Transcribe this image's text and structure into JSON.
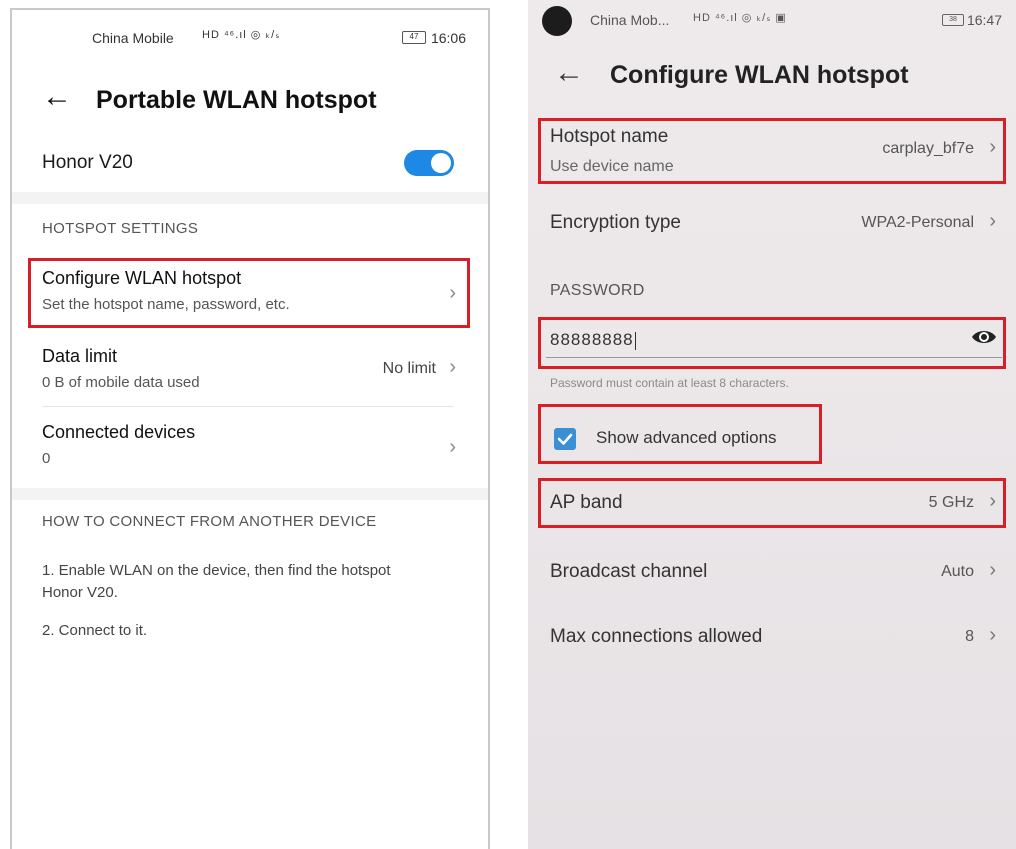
{
  "left": {
    "status": {
      "carrier": "China Mobile",
      "signal": "HD ⁴⁶.ıl ◎ ₖ/ₛ",
      "battery": "47",
      "time": "16:06"
    },
    "header": {
      "title": "Portable WLAN hotspot"
    },
    "hotspot_toggle": {
      "label": "Honor V20",
      "on": true
    },
    "section_settings": "HOTSPOT SETTINGS",
    "configure": {
      "title": "Configure WLAN hotspot",
      "subtitle": "Set the hotspot name, password, etc."
    },
    "data_limit": {
      "title": "Data limit",
      "subtitle": "0 B of mobile data used",
      "value": "No limit"
    },
    "connected": {
      "title": "Connected devices",
      "subtitle": "0"
    },
    "section_howto": "HOW TO CONNECT FROM ANOTHER DEVICE",
    "instructions": [
      "1. Enable WLAN on the device, then find the hotspot Honor V20.",
      "2. Connect to it."
    ]
  },
  "right": {
    "status": {
      "carrier": "China Mob...",
      "signal": "HD ⁴⁶.ıl ◎ ₖ/ₛ ▣",
      "battery": "38",
      "time": "16:47"
    },
    "header": {
      "title": "Configure WLAN hotspot"
    },
    "hotspot_name": {
      "title": "Hotspot name",
      "subtitle": "Use device name",
      "value": "carplay_bf7e"
    },
    "encryption": {
      "title": "Encryption type",
      "value": "WPA2-Personal"
    },
    "section_password": "PASSWORD",
    "password": {
      "value": "88888888",
      "hint": "Password must contain at least 8 characters."
    },
    "advanced": {
      "label": "Show advanced options",
      "checked": true
    },
    "ap_band": {
      "title": "AP band",
      "value": "5 GHz"
    },
    "broadcast": {
      "title": "Broadcast channel",
      "value": "Auto"
    },
    "max_conn": {
      "title": "Max connections allowed",
      "value": "8"
    }
  },
  "icons": {
    "back": "back-arrow-icon",
    "chevron": "chevron-right-icon",
    "eye": "eye-icon",
    "check": "checkbox-checked-icon"
  },
  "colors": {
    "toggle_on": "#1e88e5",
    "checkbox": "#3b8fd4",
    "highlight": "#d81f27"
  }
}
